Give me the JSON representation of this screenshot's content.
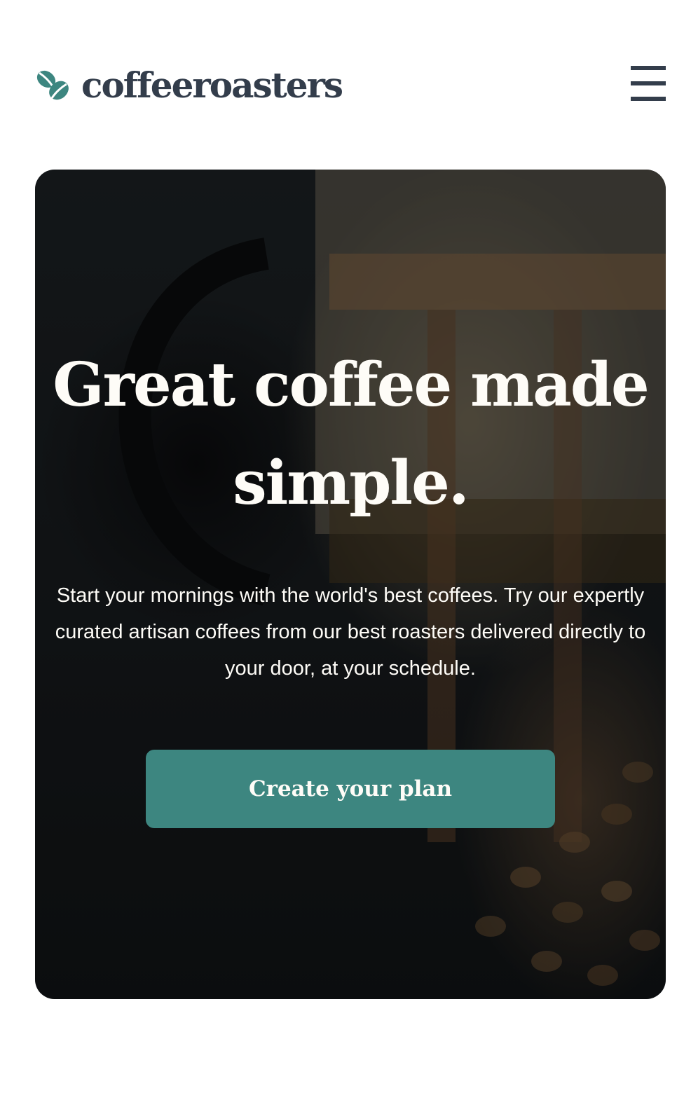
{
  "header": {
    "brand": "coffeeroasters",
    "logo_icon": "coffee-bean-logo-icon",
    "menu_icon": "hamburger-menu-icon"
  },
  "hero": {
    "title": "Great coffee made simple.",
    "description": "Start your mornings with the world's best coffees. Try our expertly curated artisan coffees from our best roasters delivered directly to your door, at your schedule.",
    "cta_label": "Create your plan",
    "background_image": "french-press-and-coffee-beans-photo"
  },
  "colors": {
    "brand_dark": "#333d4b",
    "accent_teal": "#3d8680",
    "text_light": "#fefcf7"
  }
}
